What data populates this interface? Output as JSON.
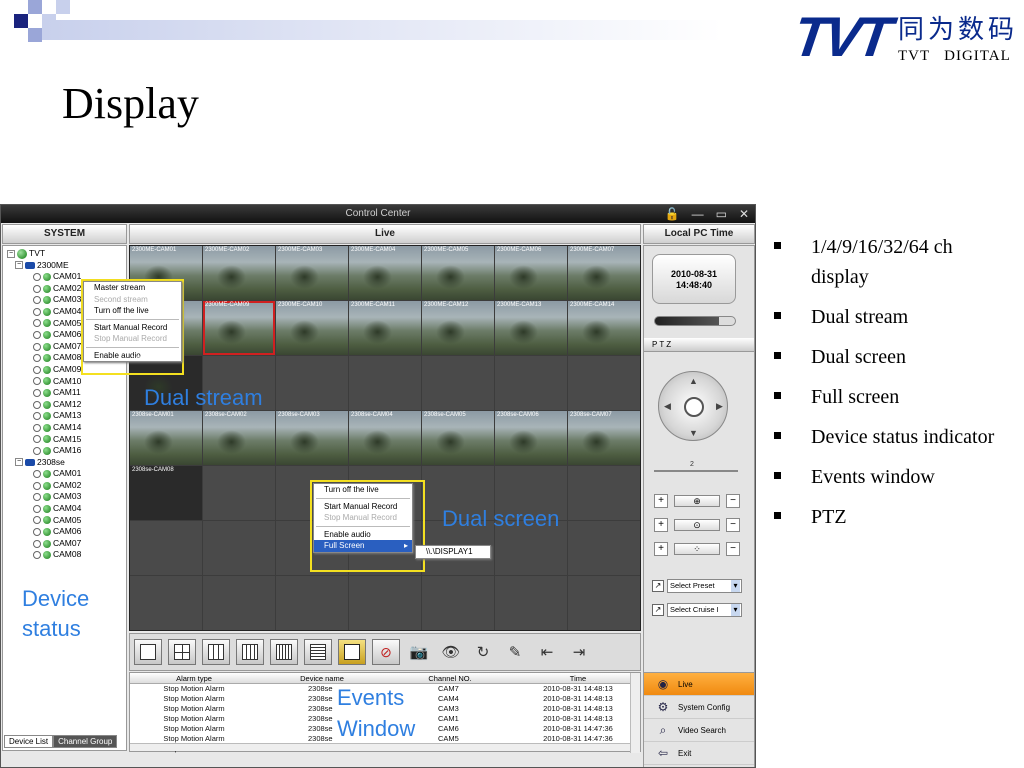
{
  "slide": {
    "title": "Display",
    "logo_brand": "TVT",
    "logo_chinese": "同为数码",
    "logo_english": "TVT   DIGITAL",
    "bullets": [
      "1/4/9/16/32/64 ch display",
      "Dual stream",
      "Dual screen",
      "Full screen",
      "Device status indicator",
      "Events window",
      "PTZ"
    ],
    "annotations": {
      "dual_stream": "Dual stream",
      "dual_screen": "Dual screen",
      "device_status_1": "Device",
      "device_status_2": "status",
      "events_1": "Events",
      "events_2": "Window"
    }
  },
  "app": {
    "title": "Control Center",
    "panels": {
      "system": "SYSTEM",
      "live": "Live",
      "local_time": "Local PC Time"
    },
    "tree": {
      "root": "TVT",
      "groups": [
        {
          "name": "2300ME",
          "cams": [
            "CAM01",
            "CAM02",
            "CAM03",
            "CAM04",
            "CAM05",
            "CAM06",
            "CAM07",
            "CAM08",
            "CAM09",
            "CAM10",
            "CAM11",
            "CAM12",
            "CAM13",
            "CAM14",
            "CAM15",
            "CAM16"
          ]
        },
        {
          "name": "2308se",
          "cams": [
            "CAM01",
            "CAM02",
            "CAM03",
            "CAM04",
            "CAM05",
            "CAM06",
            "CAM07",
            "CAM08"
          ]
        }
      ],
      "tabs": [
        "Device List",
        "Channel Group"
      ]
    },
    "grid_labels": [
      "2300ME-CAM01",
      "2300ME-CAM02",
      "2300ME-CAM03",
      "2300ME-CAM04",
      "2300ME-CAM05",
      "2300ME-CAM06",
      "2300ME-CAM07",
      "2300ME-CAM08",
      "2300ME-CAM09",
      "2300ME-CAM10",
      "2300ME-CAM11",
      "2300ME-CAM12",
      "2300ME-CAM13",
      "2300ME-CAM14",
      "2300ME-CAM16",
      "",
      "",
      "",
      "",
      "",
      "",
      "2308se-CAM01",
      "2308se-CAM02",
      "2308se-CAM03",
      "2308se-CAM04",
      "2308se-CAM05",
      "2308se-CAM06",
      "2308se-CAM07",
      "2308se-CAM08"
    ],
    "context_menu_1": {
      "items": [
        "Master stream",
        "Second stream",
        "Turn off the live",
        "Start Manual Record",
        "Stop Manual Record",
        "Enable audio"
      ]
    },
    "context_menu_2": {
      "items": [
        "Turn off the live",
        "Start Manual Record",
        "Stop Manual Record",
        "Enable audio",
        "Full Screen"
      ],
      "submenu": "\\\\.\\DISPLAY1"
    },
    "clock": {
      "date": "2010-08-31",
      "time": "14:48:40"
    },
    "ptz": {
      "title": "PTZ",
      "speed": "2",
      "preset": "Select Preset",
      "cruise": "Select Cruise I"
    },
    "events": {
      "headers": [
        "Alarm type",
        "Device name",
        "Channel NO.",
        "Time"
      ],
      "rows": [
        [
          "Stop Motion Alarm",
          "2308se",
          "CAM7",
          "2010-08-31 14:48:13"
        ],
        [
          "Stop Motion Alarm",
          "2308se",
          "CAM4",
          "2010-08-31 14:48:13"
        ],
        [
          "Stop Motion Alarm",
          "2308se",
          "CAM3",
          "2010-08-31 14:48:13"
        ],
        [
          "Stop Motion Alarm",
          "2308se",
          "CAM1",
          "2010-08-31 14:48:13"
        ],
        [
          "Stop Motion Alarm",
          "2308se",
          "CAM6",
          "2010-08-31 14:47:36"
        ],
        [
          "Stop Motion Alarm",
          "2308se",
          "CAM5",
          "2010-08-31 14:47:36"
        ],
        [
          "Stop Motion Alarm",
          "2308se",
          "CAM2",
          "2010-08-31 14:47:36"
        ]
      ]
    },
    "nav": [
      "Live",
      "System Config",
      "Video Search",
      "Exit"
    ]
  },
  "colors": {
    "accent_blue": "#2f7fe0",
    "logo_blue": "#0a2a8c",
    "nav_active": "#f08a10",
    "highlight_box": "#f4e020"
  }
}
